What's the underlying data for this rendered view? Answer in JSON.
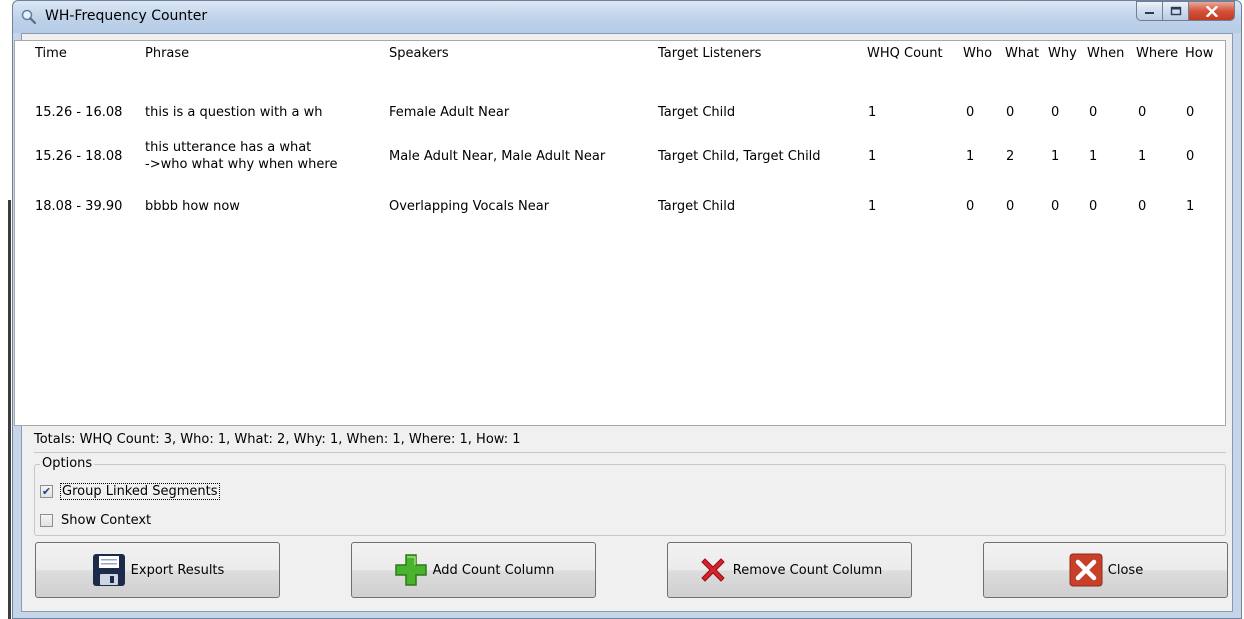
{
  "window": {
    "title": "WH-Frequency Counter",
    "icon": "magnifier-icon",
    "caption_buttons": [
      "minimize-icon",
      "maximize-icon",
      "close-icon"
    ]
  },
  "table": {
    "columns": [
      "Time",
      "Phrase",
      "Speakers",
      "Target Listeners",
      "WHQ Count",
      "Who",
      "What",
      "Why",
      "When",
      "Where",
      "How"
    ],
    "rows": [
      {
        "time": "15.26 - 16.08",
        "phrase": [
          "this is a question with a wh"
        ],
        "speakers": "Female Adult Near",
        "listeners": "Target Child",
        "whq": "1",
        "who": "0",
        "what": "0",
        "why": "0",
        "when": "0",
        "where": "0",
        "how": "0"
      },
      {
        "time": "15.26 - 18.08",
        "phrase": [
          "this utterance has a what",
          "->who what why when where"
        ],
        "speakers": "Male Adult Near, Male Adult Near",
        "listeners": "Target Child, Target Child",
        "whq": "1",
        "who": "1",
        "what": "2",
        "why": "1",
        "when": "1",
        "where": "1",
        "how": "0"
      },
      {
        "time": "18.08 - 39.90",
        "phrase": [
          "bbbb how now"
        ],
        "speakers": "Overlapping Vocals Near",
        "listeners": "Target Child",
        "whq": "1",
        "who": "0",
        "what": "0",
        "why": "0",
        "when": "0",
        "where": "0",
        "how": "1"
      }
    ]
  },
  "totals": "Totals: WHQ Count: 3, Who: 1, What: 2, Why: 1, When: 1, Where: 1, How: 1",
  "options": {
    "legend": "Options",
    "group_linked": {
      "label": "Group Linked Segments",
      "checked": true
    },
    "show_context": {
      "label": "Show Context",
      "checked": false
    }
  },
  "buttons": {
    "export": {
      "label": "Export Results",
      "icon": "floppy-disk-icon"
    },
    "add": {
      "label": "Add Count Column",
      "icon": "green-plus-icon"
    },
    "remove": {
      "label": "Remove Count Column",
      "icon": "red-x-icon"
    },
    "close": {
      "label": "Close",
      "icon": "close-x-icon"
    }
  },
  "colors": {
    "titlebar": "#c5d6ea",
    "close_button": "#c94a30",
    "checkbox_tick": "#1f3f8f"
  }
}
